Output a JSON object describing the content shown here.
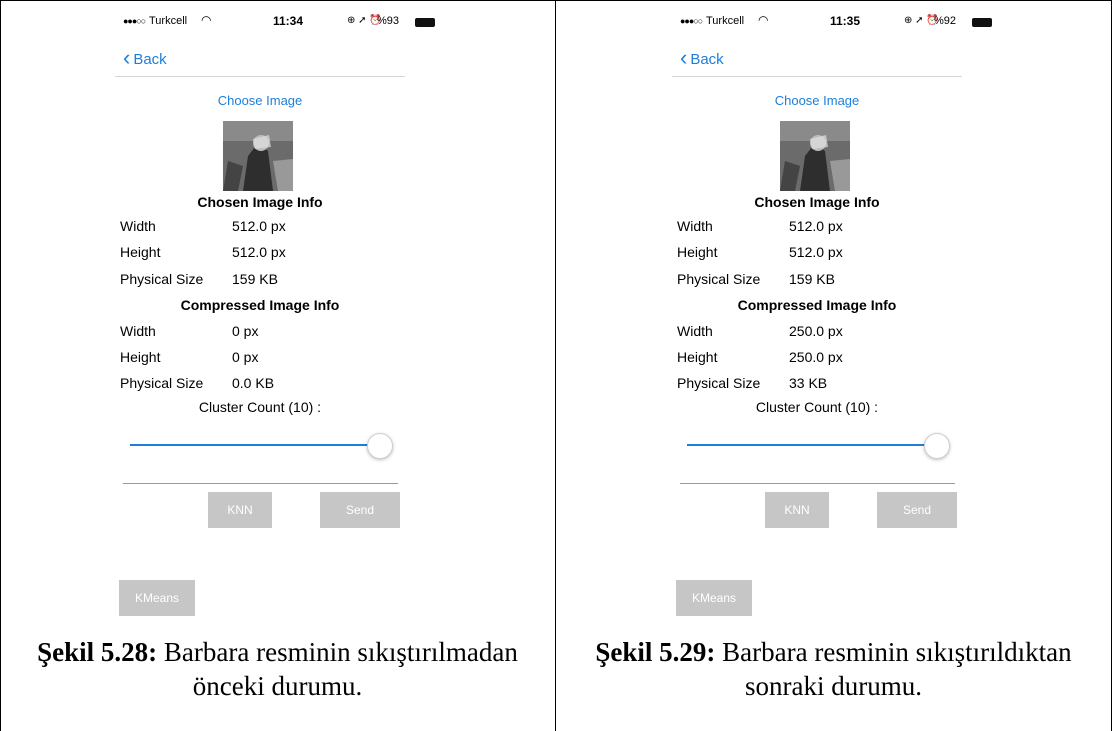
{
  "screens": [
    {
      "status": {
        "carrier": "Turkcell",
        "time": "11:34",
        "battery": "%93"
      },
      "back_label": "Back",
      "choose_label": "Choose Image",
      "chosen_heading": "Chosen Image Info",
      "chosen": [
        {
          "label": "Width",
          "value": "512.0 px"
        },
        {
          "label": "Height",
          "value": "512.0 px"
        },
        {
          "label": "Physical Size",
          "value": "159 KB"
        }
      ],
      "compressed_heading": "Compressed Image Info",
      "compressed": [
        {
          "label": "Width",
          "value": "0 px"
        },
        {
          "label": "Height",
          "value": "0 px"
        },
        {
          "label": "Physical Size",
          "value": "0.0 KB"
        }
      ],
      "cluster_label": "Cluster Count (10) :",
      "slider_level": 1.0,
      "knn_label": "KNN",
      "send_label": "Send",
      "kmeans_label": "KMeans"
    },
    {
      "status": {
        "carrier": "Turkcell",
        "time": "11:35",
        "battery": "%92"
      },
      "back_label": "Back",
      "choose_label": "Choose Image",
      "chosen_heading": "Chosen Image Info",
      "chosen": [
        {
          "label": "Width",
          "value": "512.0 px"
        },
        {
          "label": "Height",
          "value": "512.0 px"
        },
        {
          "label": "Physical Size",
          "value": "159 KB"
        }
      ],
      "compressed_heading": "Compressed Image Info",
      "compressed": [
        {
          "label": "Width",
          "value": "250.0 px"
        },
        {
          "label": "Height",
          "value": "250.0 px"
        },
        {
          "label": "Physical Size",
          "value": "33 KB"
        }
      ],
      "cluster_label": "Cluster Count (10) :",
      "slider_level": 1.0,
      "knn_label": "KNN",
      "send_label": "Send",
      "kmeans_label": "KMeans"
    }
  ],
  "captions": [
    {
      "label": "Şekil 5.28:",
      "text": "Barbara resminin sıkıştırılmadan önceki durumu."
    },
    {
      "label": "Şekil 5.29:",
      "text": "Barbara resminin sıkıştırıldıktan sonraki durumu."
    }
  ],
  "colors": {
    "link": "#1e7ed9",
    "button": "#c6c6c6"
  }
}
